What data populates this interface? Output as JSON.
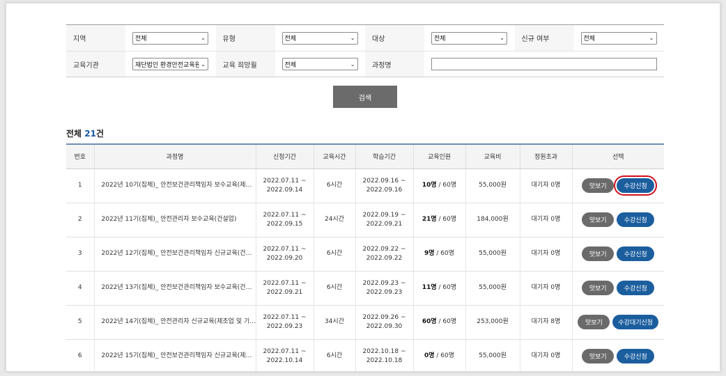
{
  "filters": {
    "row1": [
      {
        "label": "지역",
        "value": "전체"
      },
      {
        "label": "유형",
        "value": "전체"
      },
      {
        "label": "대상",
        "value": "전체"
      },
      {
        "label": "신규 여부",
        "value": "전체"
      }
    ],
    "row2": [
      {
        "label": "교육기관",
        "value": "재단법인 환경안전교육원"
      },
      {
        "label": "교육 희망월",
        "value": "전체"
      },
      {
        "label": "과정명",
        "value": ""
      }
    ]
  },
  "search_label": "검색",
  "total": {
    "prefix": "전체 ",
    "count": "21",
    "suffix": "건"
  },
  "table": {
    "headers": [
      "번호",
      "과정명",
      "신청기간",
      "교육시간",
      "학습기간",
      "교육인원",
      "교육비",
      "정원초과",
      "선택"
    ],
    "rows": [
      {
        "no": "1",
        "title": "2022년 10기(집체)_ 안전보건관리책임자 보수교육(제…",
        "apply_from": "2022.07.11 ~",
        "apply_to": "2022.09.14",
        "hours": "6시간",
        "study_from": "2022.09.16 ~",
        "study_to": "2022.09.16",
        "enrolled": "10명",
        "capacity": " / 60명",
        "fee": "55,000원",
        "waitlist": "대기자 0명",
        "preview": "맛보기",
        "action": "수강신청"
      },
      {
        "no": "2",
        "title": "2022년 11기(집체)_ 안전관리자 보수교육(건설업)",
        "apply_from": "2022.07.11 ~",
        "apply_to": "2022.09.15",
        "hours": "24시간",
        "study_from": "2022.09.19 ~",
        "study_to": "2022.09.21",
        "enrolled": "21명",
        "capacity": " / 60명",
        "fee": "184,000원",
        "waitlist": "대기자 0명",
        "preview": "맛보기",
        "action": "수강신청"
      },
      {
        "no": "3",
        "title": "2022년 12기(집체)_ 안전보건관리책임자 신규교육(건…",
        "apply_from": "2022.07.11 ~",
        "apply_to": "2022.09.20",
        "hours": "6시간",
        "study_from": "2022.09.22 ~",
        "study_to": "2022.09.22",
        "enrolled": "9명",
        "capacity": " / 60명",
        "fee": "55,000원",
        "waitlist": "대기자 0명",
        "preview": "맛보기",
        "action": "수강신청"
      },
      {
        "no": "4",
        "title": "2022년 13기(집체)_ 안전보건관리책임자 보수교육(건…",
        "apply_from": "2022.07.11 ~",
        "apply_to": "2022.09.21",
        "hours": "6시간",
        "study_from": "2022.09.23 ~",
        "study_to": "2022.09.23",
        "enrolled": "11명",
        "capacity": " / 60명",
        "fee": "55,000원",
        "waitlist": "대기자 0명",
        "preview": "맛보기",
        "action": "수강신청"
      },
      {
        "no": "5",
        "title": "2022년 14기(집체)_ 안전관리자 신규교육(제조업 및 기…",
        "apply_from": "2022.07.11 ~",
        "apply_to": "2022.09.23",
        "hours": "34시간",
        "study_from": "2022.09.26 ~",
        "study_to": "2022.09.30",
        "enrolled": "60명",
        "capacity": " / 60명",
        "fee": "253,000원",
        "waitlist": "대기자 8명",
        "preview": "맛보기",
        "action": "수강대기신청"
      },
      {
        "no": "6",
        "title": "2022년 15기(집체)_ 안전보건관리책임자 신규교육(제…",
        "apply_from": "2022.07.11 ~",
        "apply_to": "2022.10.14",
        "hours": "6시간",
        "study_from": "2022.10.18 ~",
        "study_to": "2022.10.18",
        "enrolled": "0명",
        "capacity": " / 60명",
        "fee": "55,000원",
        "waitlist": "대기자 0명",
        "preview": "맛보기",
        "action": "수강신청"
      }
    ]
  },
  "colors": {
    "accent": "#1b5e9e",
    "highlight": "#d0101d",
    "preview": "#6a6a6a"
  }
}
